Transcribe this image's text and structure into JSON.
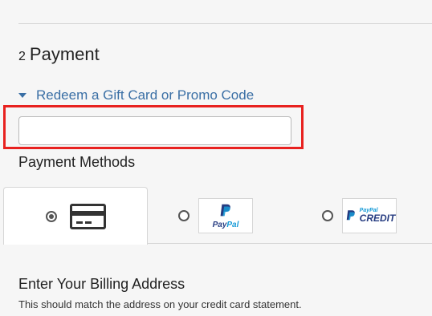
{
  "payment": {
    "step_number": "2",
    "title": "Payment",
    "redeem_label": "Redeem a Gift Card or Promo Code",
    "code_input": {
      "value": "",
      "placeholder": ""
    },
    "highlight_color": "#e8211f",
    "link_color": "#3a6fa5"
  },
  "methods": {
    "title": "Payment Methods",
    "options": [
      {
        "id": "credit-card",
        "icon": "credit-card-icon",
        "selected": true
      },
      {
        "id": "paypal",
        "icon": "paypal-logo",
        "logo_text_1": "Pay",
        "logo_text_2": "Pal",
        "selected": false
      },
      {
        "id": "paypal-credit",
        "icon": "paypal-credit-logo",
        "logo_small": "PayPal",
        "logo_big": "CREDIT",
        "selected": false
      }
    ]
  },
  "billing": {
    "title": "Enter Your Billing Address",
    "subtitle": "This should match the address on your credit card statement."
  }
}
